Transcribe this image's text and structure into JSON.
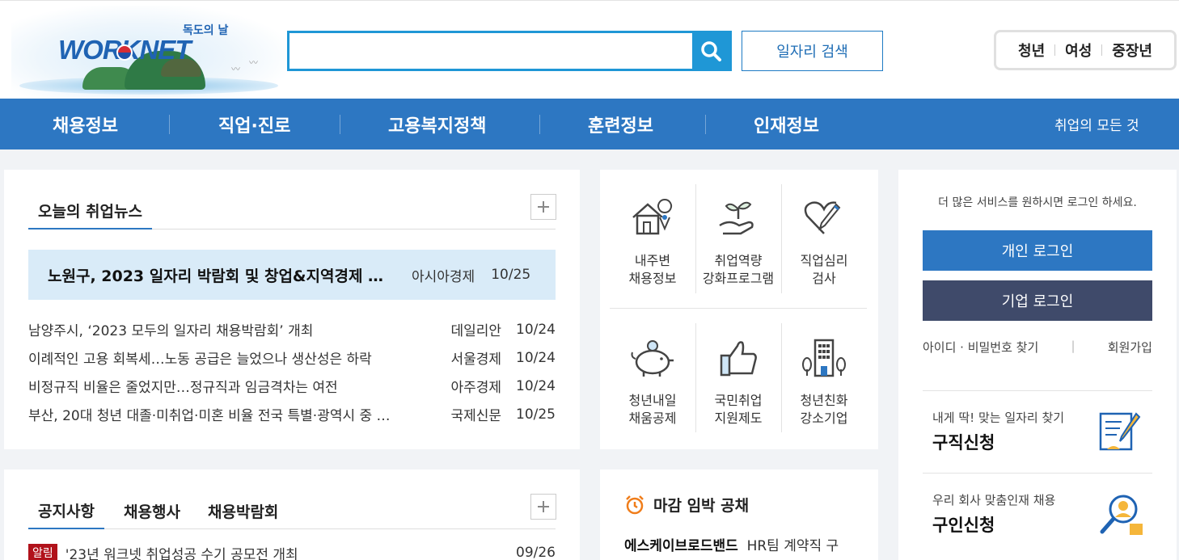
{
  "logo": {
    "text": "WORKNET",
    "subtitle": "독도의 날"
  },
  "search": {
    "placeholder": "",
    "value": "",
    "job_search_label": "일자리 검색"
  },
  "target_tabs": [
    "청년",
    "여성",
    "중장년"
  ],
  "gnb": {
    "items": [
      "채용정보",
      "직업·진로",
      "고용복지정책",
      "훈련정보",
      "인재정보"
    ],
    "all_label": "취업의 모든 것"
  },
  "news": {
    "title": "오늘의 취업뉴스",
    "headline": {
      "title": "노원구, 2023 일자리 박람회 및 창업&지역경제 …",
      "source": "아시아경제",
      "date": "10/25"
    },
    "items": [
      {
        "title": "남양주시, ‘2023 모두의 일자리 채용박람회’ 개최",
        "source": "데일리안",
        "date": "10/24"
      },
      {
        "title": "이례적인 고용 회복세…노동 공급은 늘었으나 생산성은 하락",
        "source": "서울경제",
        "date": "10/24"
      },
      {
        "title": "비정규직 비율은 줄었지만…정규직과 임금격차는 여전",
        "source": "아주경제",
        "date": "10/24"
      },
      {
        "title": "부산, 20대 청년 대졸·미취업·미혼 비율 전국 특별·광역시 중 …",
        "source": "국제신문",
        "date": "10/25"
      }
    ]
  },
  "services": [
    {
      "line1": "내주변",
      "line2": "채용정보",
      "icon": "house-location-icon"
    },
    {
      "line1": "취업역량",
      "line2": "강화프로그램",
      "icon": "sprout-hand-icon"
    },
    {
      "line1": "직업심리",
      "line2": "검사",
      "icon": "heart-pencil-icon"
    },
    {
      "line1": "청년내일",
      "line2": "채움공제",
      "icon": "piggy-bank-icon"
    },
    {
      "line1": "국민취업",
      "line2": "지원제도",
      "icon": "thumbs-up-icon"
    },
    {
      "line1": "청년친화",
      "line2": "강소기업",
      "icon": "building-icon"
    }
  ],
  "login": {
    "message": "더 많은 서비스를 원하시면 로그인 하세요.",
    "personal_label": "개인 로그인",
    "company_label": "기업 로그인",
    "find_label": "아이디 · 비밀번호 찾기",
    "join_label": "회원가입",
    "promo1": {
      "sub": "내게 딱! 맞는 일자리 찾기",
      "main": "구직신청"
    },
    "promo2": {
      "sub": "우리 회사 맞춤인재 채용",
      "main": "구인신청"
    }
  },
  "notice": {
    "tabs": [
      "공지사항",
      "채용행사",
      "채용박람회"
    ],
    "item": {
      "badge": "알림",
      "title": "'23년 워크넷 취업성공 수기 공모전 개최",
      "date": "09/26"
    }
  },
  "deadline": {
    "title": "마감 임박 공채",
    "company": "에스케이브로드밴드",
    "job": "HR팀 계약직 구"
  },
  "colors": {
    "nav": "#2d77c2",
    "search": "#1f97d6",
    "personal_login": "#2d77c2",
    "company_login": "#3f4a6a",
    "badge": "#b1121b"
  }
}
